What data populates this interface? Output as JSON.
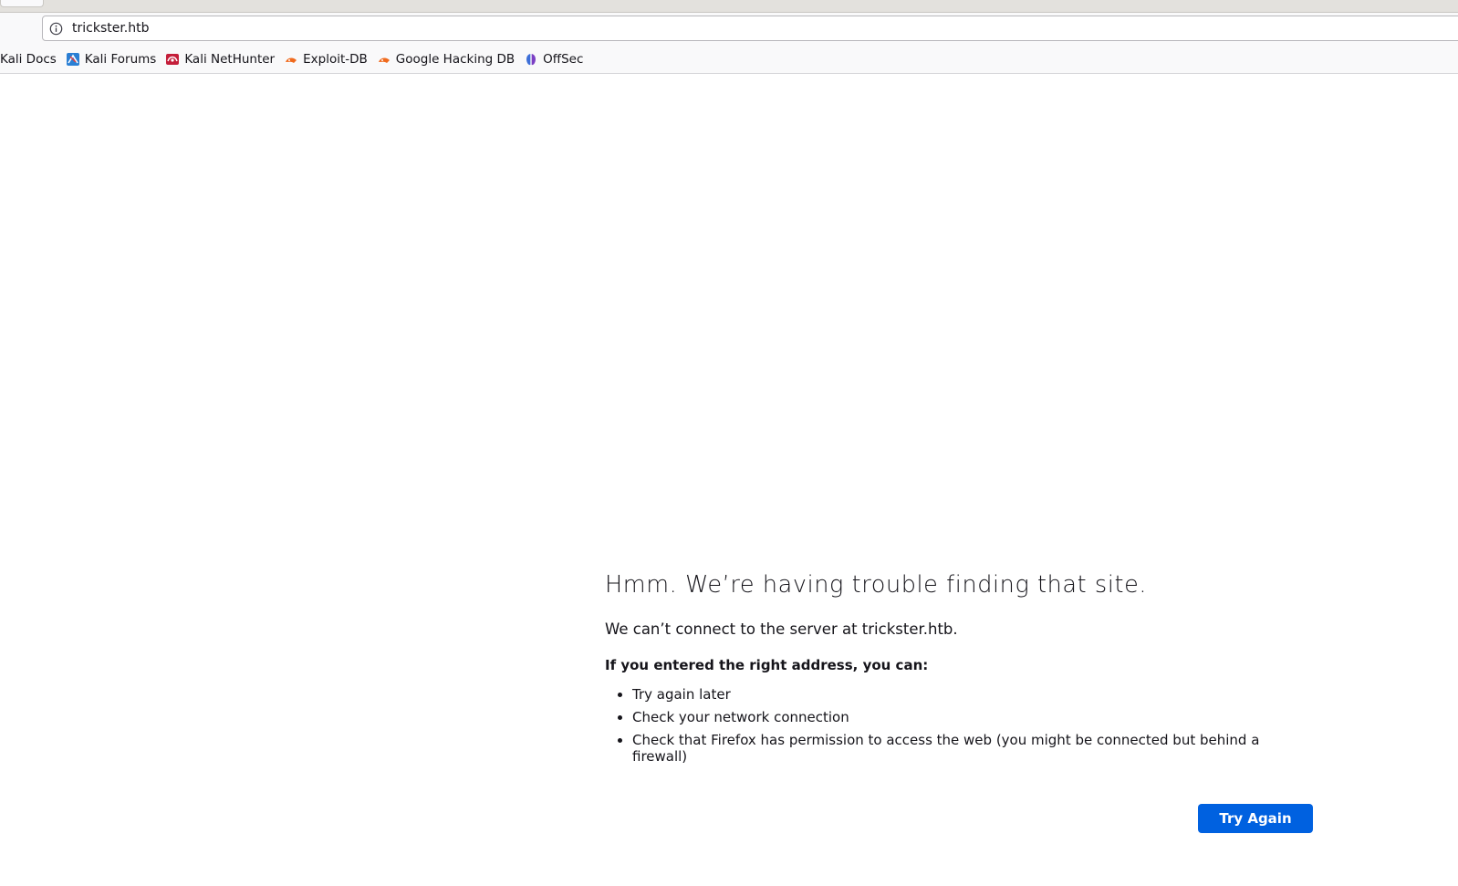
{
  "address_bar": {
    "url": "trickster.htb",
    "info_icon": "info-circle-icon"
  },
  "bookmarks": [
    {
      "label": "Kali Docs",
      "icon": "none"
    },
    {
      "label": "Kali Forums",
      "icon": "kali-forums-icon"
    },
    {
      "label": "Kali NetHunter",
      "icon": "kali-nethunter-icon"
    },
    {
      "label": "Exploit-DB",
      "icon": "exploit-db-icon"
    },
    {
      "label": "Google Hacking DB",
      "icon": "exploit-db-icon"
    },
    {
      "label": "OffSec",
      "icon": "offsec-icon"
    }
  ],
  "error_page": {
    "title": "Hmm. We’re having trouble finding that site.",
    "description": "We can’t connect to the server at trickster.htb.",
    "suggestions_heading": "If you entered the right address, you can:",
    "suggestions": [
      "Try again later",
      "Check your network connection",
      "Check that Firefox has permission to access the web (you might be connected but behind a firewall)"
    ],
    "try_again_label": "Try Again"
  },
  "colors": {
    "primary_button": "#0061e0",
    "toolbar_bg": "#f9f9fa",
    "text": "#15141a"
  }
}
